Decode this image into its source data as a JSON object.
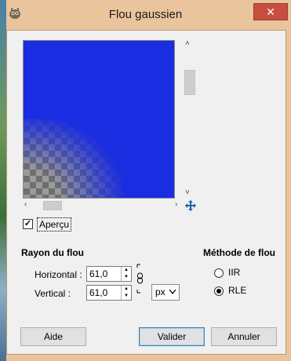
{
  "window": {
    "title": "Flou gaussien",
    "close_glyph": "✕"
  },
  "preview": {
    "background_color": "#1b2de0",
    "checkbox_checked": "✓",
    "label": "Aperçu"
  },
  "blur_radius": {
    "section_title": "Rayon du flou",
    "horizontal_label": "Horizontal :",
    "horizontal_value": "61,0",
    "vertical_label": "Vertical :",
    "vertical_value": "61,0",
    "unit": "px",
    "chain_icon": "chain-link-icon"
  },
  "blur_method": {
    "section_title": "Méthode de flou",
    "options": [
      {
        "label": "IIR",
        "selected": false
      },
      {
        "label": "RLE",
        "selected": true
      }
    ]
  },
  "buttons": {
    "help": "Aide",
    "ok": "Valider",
    "cancel": "Annuler"
  }
}
